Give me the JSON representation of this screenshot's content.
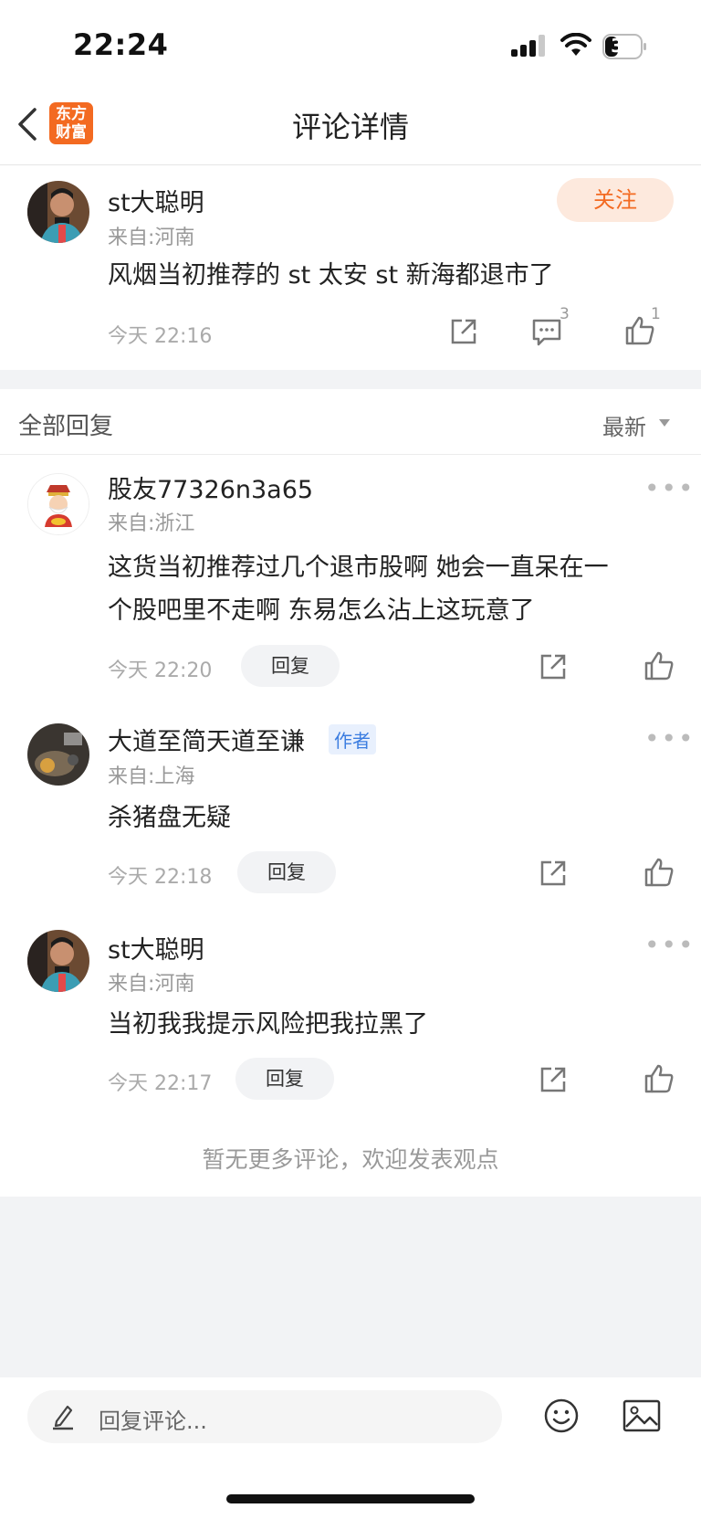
{
  "status": {
    "time": "22:24",
    "battery": "34"
  },
  "nav": {
    "logo_line1": "东方",
    "logo_line2": "财富",
    "title": "评论详情"
  },
  "main": {
    "username": "st大聪明",
    "location": "来自:河南",
    "content": "风烟当初推荐的 st 太安 st 新海都退市了",
    "time": "今天 22:16",
    "follow_label": "关注",
    "comment_count": "3",
    "like_count": "1"
  },
  "replies_section": {
    "title": "全部回复",
    "sort_label": "最新"
  },
  "replies": [
    {
      "username": "股友77326n3a65",
      "location": "来自:浙江",
      "content_line1": "这货当初推荐过几个退市股啊 她会一直呆在一",
      "content_line2": "个股吧里不走啊 东易怎么沾上这玩意了",
      "time": "今天 22:20",
      "reply_label": "回复"
    },
    {
      "username": "大道至简天道至谦",
      "badge": "作者",
      "location": "来自:上海",
      "content_line1": "杀猪盘无疑",
      "time": "今天 22:18",
      "reply_label": "回复"
    },
    {
      "username": "st大聪明",
      "location": "来自:河南",
      "content_line1": "当初我我提示风险把我拉黑了",
      "time": "今天 22:17",
      "reply_label": "回复"
    }
  ],
  "end_note": "暂无更多评论，欢迎发表观点",
  "bottom": {
    "placeholder": "回复评论..."
  },
  "icons": [
    "back-icon",
    "share-icon",
    "comment-icon",
    "like-icon",
    "more-icon",
    "pencil-icon",
    "emoji-icon",
    "image-icon",
    "signal-icon",
    "wifi-icon",
    "battery-icon"
  ],
  "colors": {
    "accent": "#f36a21",
    "author_badge": "#3b7de0"
  }
}
